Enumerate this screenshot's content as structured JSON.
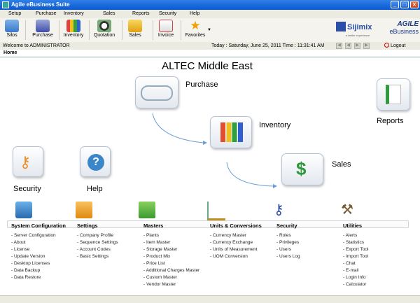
{
  "window": {
    "title": "Agile eBusiness Suite"
  },
  "menu": [
    "Setup",
    "Purchase",
    "Inventory",
    "Sales",
    "Reports",
    "Security",
    "Help"
  ],
  "toolbar": {
    "buttons": [
      "Silos",
      "Purchase",
      "Inventory",
      "Quotation",
      "Sales",
      "Invoice",
      "Favorites"
    ]
  },
  "brand": {
    "sijimix": "Sijimix",
    "sijimix_sub": "a better experience",
    "agile_1": "AGILE",
    "agile_2": "eBusiness"
  },
  "status": {
    "welcome": "Welcome to ADMINISTRATOR",
    "datetime": "Today : Saturday, June 25, 2011  Time : 11:31:41 AM",
    "logout": "Logout"
  },
  "tab": {
    "home": "Home"
  },
  "company": "ALTEC Middle East",
  "flow": {
    "purchase": "Purchase",
    "inventory": "Inventory",
    "sales": "Sales",
    "reports": "Reports",
    "security": "Security",
    "help": "Help"
  },
  "sections": [
    {
      "title": "System Configuration",
      "items": [
        "Server Configuration",
        "About",
        "License",
        "Update Version",
        "Desktop Licenses",
        "Data Backup",
        "Data Restore"
      ]
    },
    {
      "title": "Settings",
      "items": [
        "Company Profile",
        "Sequence Settings",
        "Account Codes",
        "Basic Settings"
      ]
    },
    {
      "title": "Masters",
      "items": [
        "Plants",
        "Item Master",
        "Storage Master",
        "Product Mix",
        "Price List",
        "Additional Charges Master",
        "Custom Master",
        "Vendor Master"
      ]
    },
    {
      "title": "Units & Conversions",
      "items": [
        "Currency Master",
        "Currency Exchange",
        "Units of Measurement",
        "UOM Conversion"
      ]
    },
    {
      "title": "Security",
      "items": [
        "Roles",
        "Privileges",
        "Users",
        "Users Log"
      ]
    },
    {
      "title": "Utilities",
      "items": [
        "Alerts",
        "Statistics",
        "Export Tool",
        "Import Tool",
        "Chat",
        "E-mail",
        "Login Info",
        "Calculator"
      ]
    }
  ],
  "colors": {
    "titlebar": "#0a58d0",
    "accent_green": "#2e9a3c",
    "orange": "#f08a1c"
  }
}
